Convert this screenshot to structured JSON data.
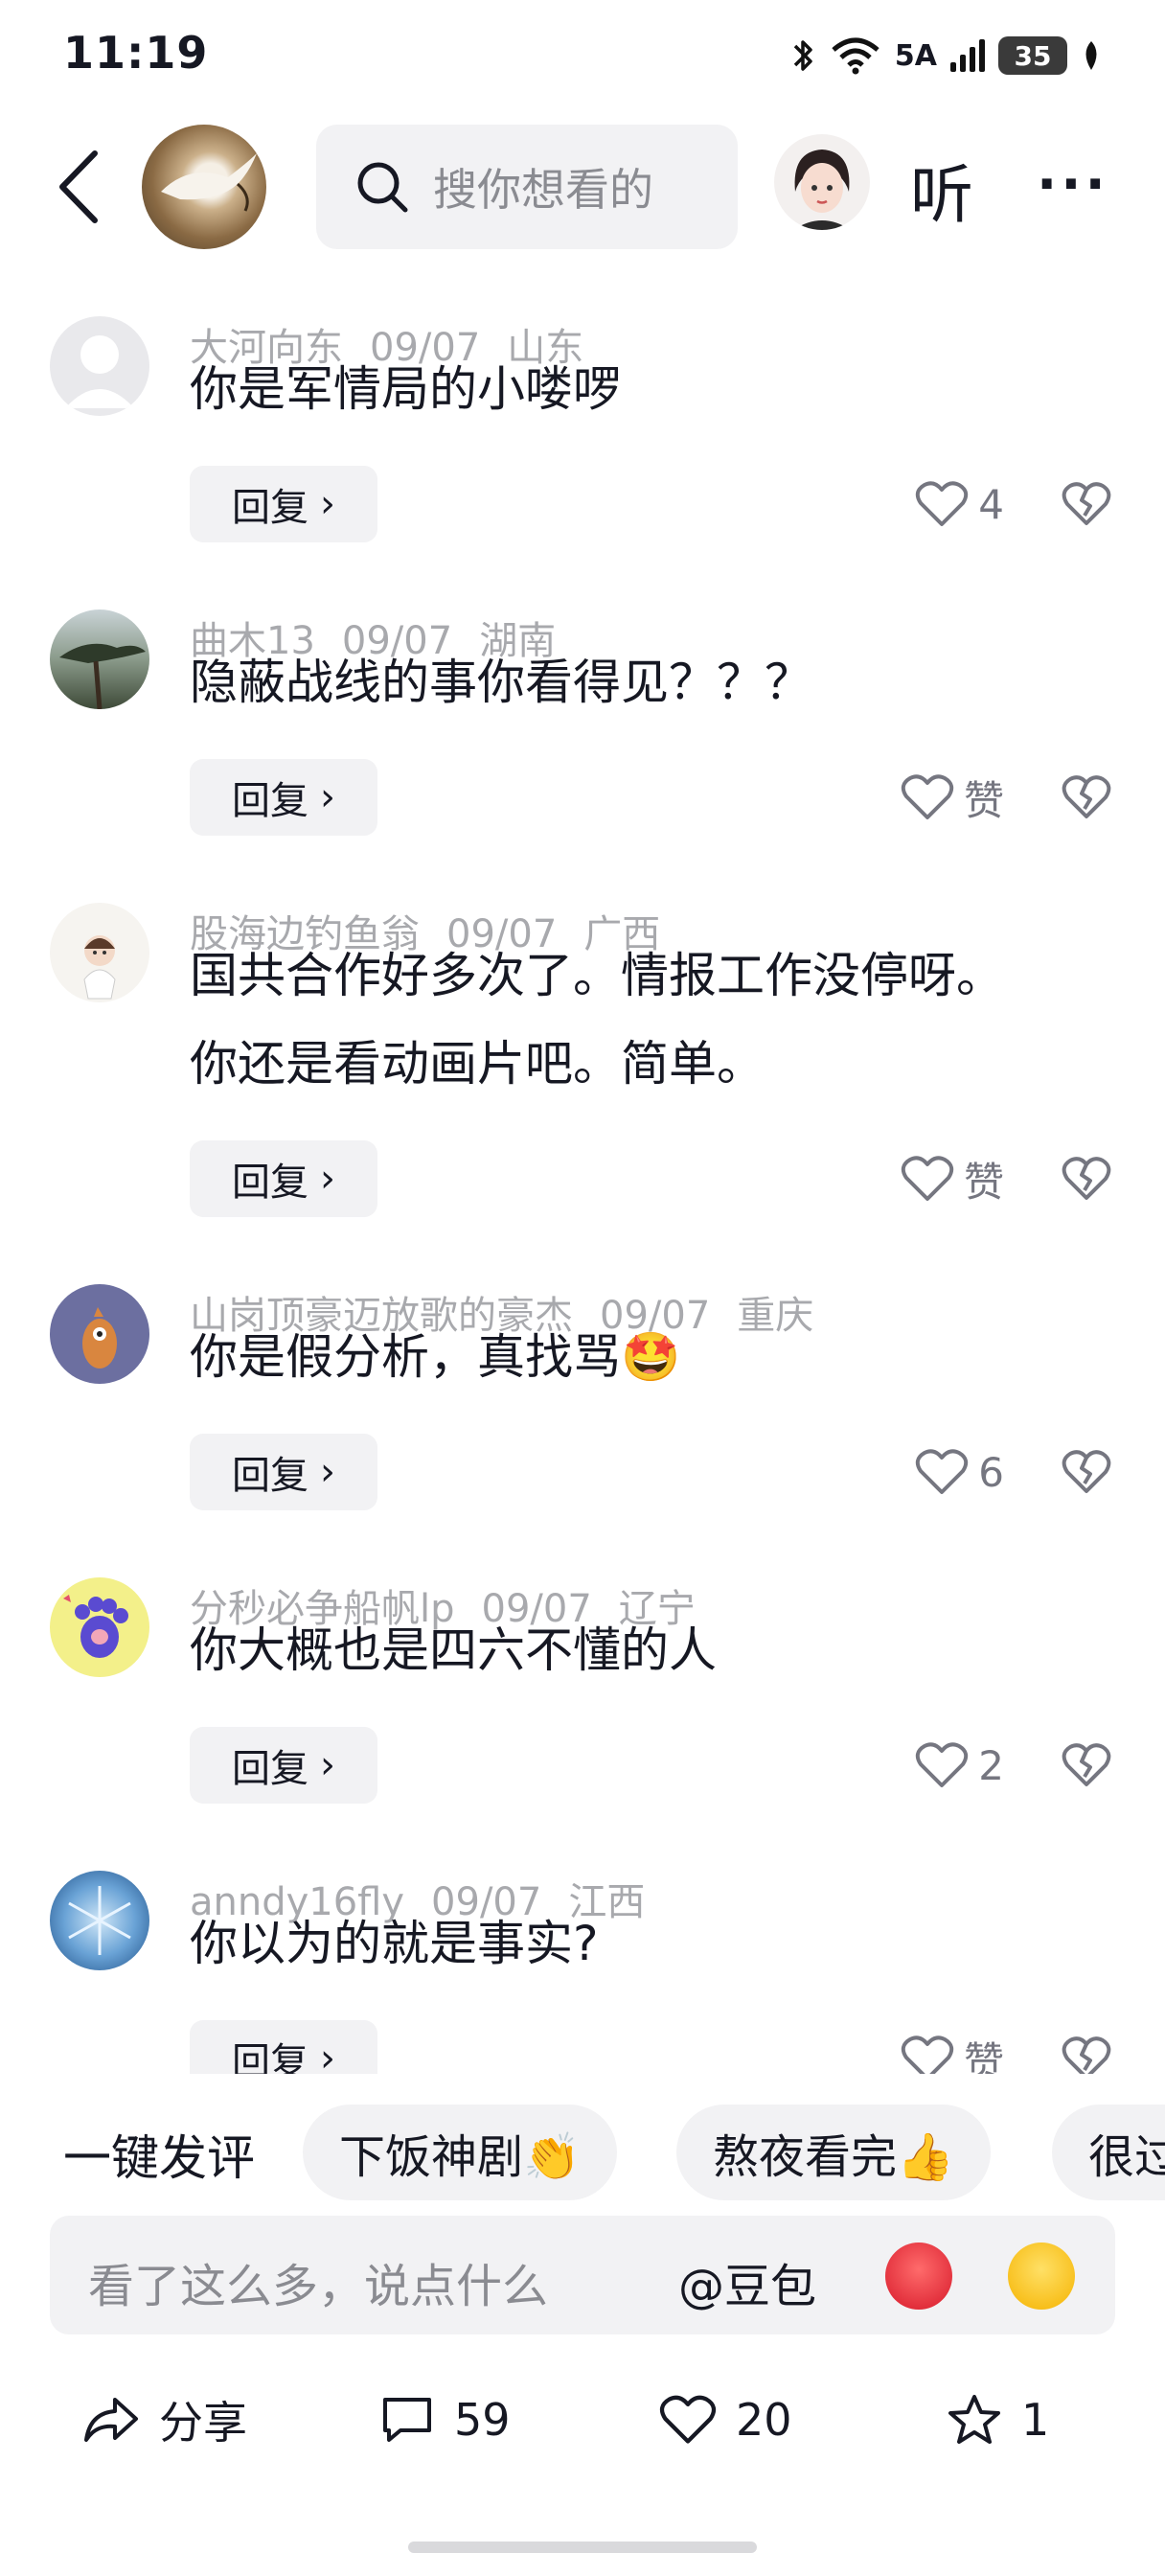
{
  "status_bar": {
    "time": "11:19",
    "network": "5A",
    "battery": "35"
  },
  "header": {
    "search_placeholder": "搜你想看的",
    "listen_label": "听",
    "more_label": "···"
  },
  "comments": [
    {
      "user": "大河向东",
      "date": "09/07",
      "region": "山东",
      "text": "你是军情局的小喽啰",
      "extra": "",
      "reply": "回复",
      "likes": "4"
    },
    {
      "user": "曲木13",
      "date": "09/07",
      "region": "湖南",
      "text": "隐蔽战线的事你看得见？？？",
      "extra": "",
      "reply": "回复",
      "likes": "赞"
    },
    {
      "user": "股海边钓鱼翁",
      "date": "09/07",
      "region": "广西",
      "text": "国共合作好多次了。情报工作没停呀。",
      "extra": "你还是看动画片吧。简单。",
      "reply": "回复",
      "likes": "赞"
    },
    {
      "user": "山岗顶豪迈放歌的豪杰",
      "date": "09/07",
      "region": "重庆",
      "text": "你是假分析，真找骂🤩",
      "extra": "",
      "reply": "回复",
      "likes": "6"
    },
    {
      "user": "分秒必争船帆lp",
      "date": "09/07",
      "region": "辽宁",
      "text": "你大概也是四六不懂的人",
      "extra": "",
      "reply": "回复",
      "likes": "2"
    },
    {
      "user": "anndy16fly",
      "date": "09/07",
      "region": "江西",
      "text": "你以为的就是事实?",
      "extra": "",
      "reply": "回复",
      "likes": "赞"
    }
  ],
  "quick_comments": {
    "label": "一键发评",
    "chips": [
      "下饭神剧👏",
      "熬夜看完👍",
      "很过"
    ]
  },
  "input": {
    "placeholder": "看了这么多，说点什么",
    "mention": "@豆包"
  },
  "actions": {
    "share": "分享",
    "comments": "59",
    "likes": "20",
    "favorites": "1"
  },
  "colors": {
    "text": "#161823",
    "meta": "#a8a9ad",
    "chip_bg": "#f2f2f4"
  }
}
